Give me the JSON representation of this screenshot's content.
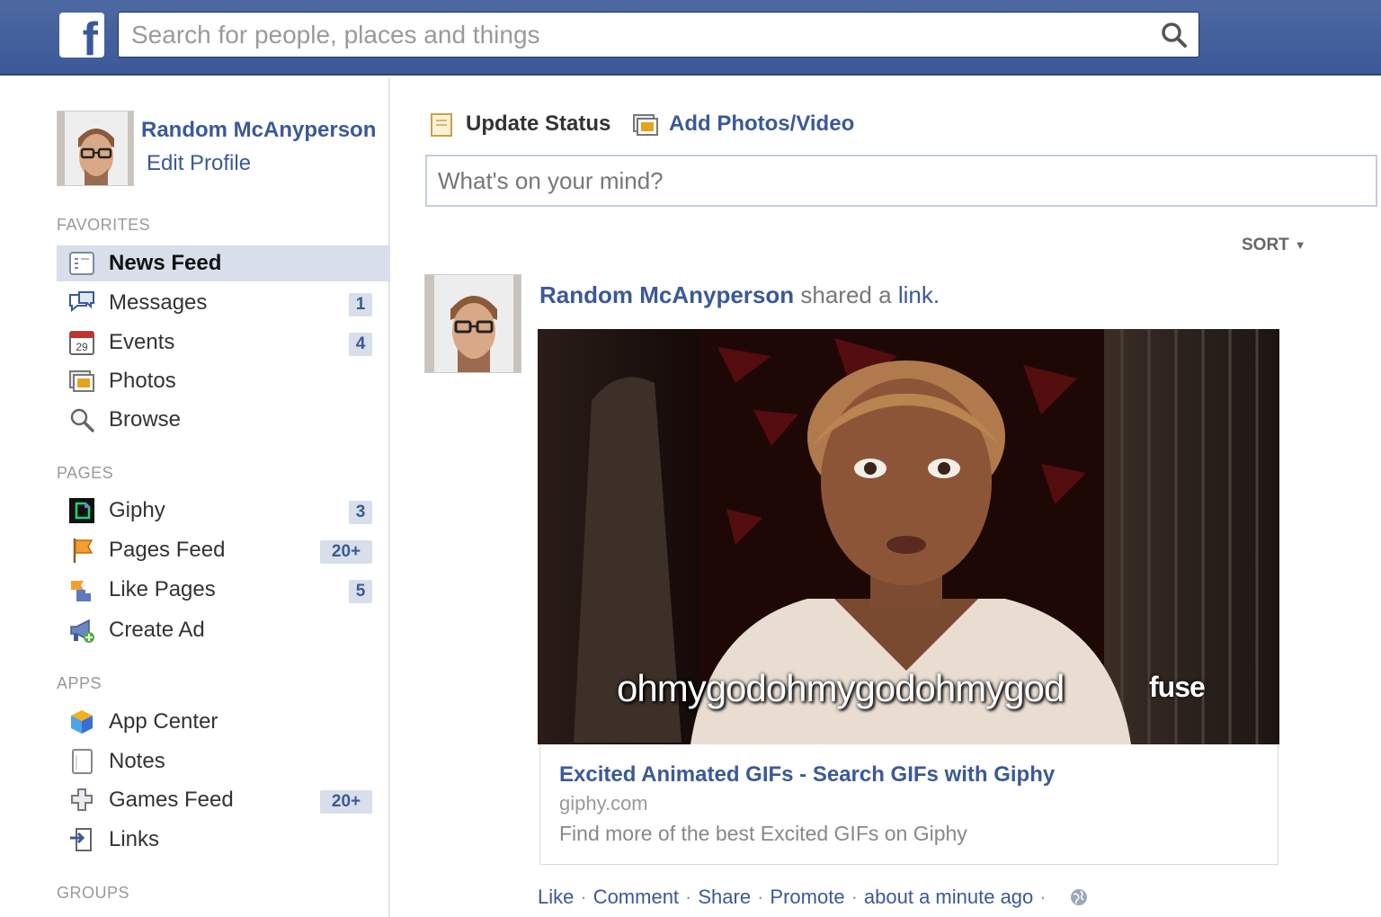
{
  "header": {
    "search_placeholder": "Search for people, places and things"
  },
  "sidebar": {
    "profile": {
      "name": "Random McAnyperson",
      "edit_label": "Edit Profile"
    },
    "favorites_heading": "FAVORITES",
    "favorites": [
      {
        "label": "News Feed",
        "icon": "news-feed-icon",
        "active": true
      },
      {
        "label": "Messages",
        "icon": "messages-icon",
        "count": "1"
      },
      {
        "label": "Events",
        "icon": "calendar-icon",
        "count": "4",
        "icon_text": "29"
      },
      {
        "label": "Photos",
        "icon": "photos-icon"
      },
      {
        "label": "Browse",
        "icon": "magnifier-icon"
      }
    ],
    "pages_heading": "PAGES",
    "pages": [
      {
        "label": "Giphy",
        "icon": "giphy-icon",
        "count": "3"
      },
      {
        "label": "Pages Feed",
        "icon": "flag-icon",
        "count": "20+"
      },
      {
        "label": "Like Pages",
        "icon": "like-pages-icon",
        "count": "5"
      },
      {
        "label": "Create Ad",
        "icon": "megaphone-icon"
      }
    ],
    "apps_heading": "APPS",
    "apps": [
      {
        "label": "App Center",
        "icon": "app-center-icon"
      },
      {
        "label": "Notes",
        "icon": "notes-icon"
      },
      {
        "label": "Games Feed",
        "icon": "puzzle-icon",
        "count": "20+"
      },
      {
        "label": "Links",
        "icon": "links-icon"
      }
    ],
    "groups_heading": "GROUPS"
  },
  "composer": {
    "update_status_label": "Update Status",
    "add_photos_label": "Add Photos/Video",
    "placeholder": "What's on your mind?"
  },
  "feed": {
    "sort_label": "SORT"
  },
  "post": {
    "author": "Random McAnyperson",
    "action": "shared a",
    "action_link": "link.",
    "gif_caption": "ohmygodohmygodohmygod",
    "gif_brand": "fuse",
    "link_title": "Excited Animated GIFs - Search GIFs with Giphy",
    "link_domain": "giphy.com",
    "link_description": "Find more of the best Excited GIFs on Giphy",
    "footer": {
      "like": "Like",
      "comment": "Comment",
      "share": "Share",
      "promote": "Promote",
      "timestamp": "about a minute ago"
    }
  },
  "colors": {
    "brand_blue": "#3b5998",
    "header_blue": "#4e69a2",
    "active_item": "#d8dfea"
  }
}
